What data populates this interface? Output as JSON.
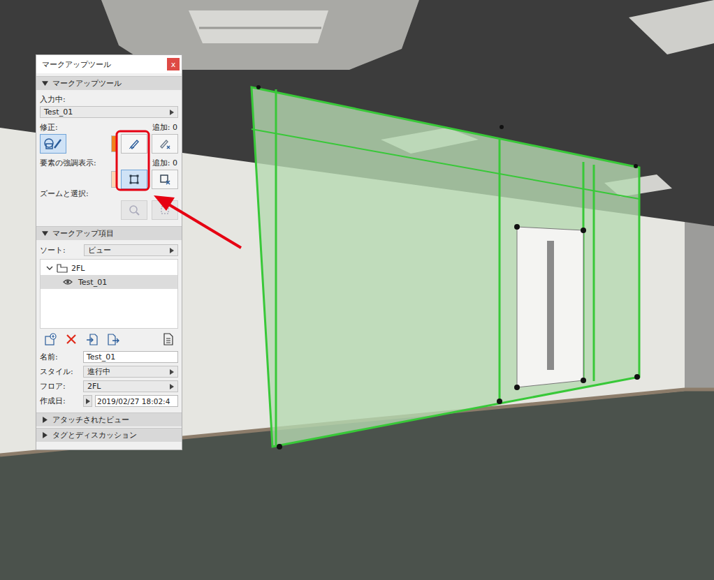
{
  "window": {
    "title": "マークアップツール",
    "close": "x"
  },
  "tool_section": {
    "title": "マークアップツール",
    "expanded": true,
    "active_label": "入力中:",
    "active_value": "Test_01",
    "modify": {
      "label": "修正:",
      "added": "追加: 0",
      "mode_selected": true,
      "color": "#f0821e",
      "add_selected": false,
      "remove_selected": false
    },
    "highlight": {
      "label": "要素の強調表示:",
      "added": "追加: 0",
      "color": "#fcd6b4",
      "add_selected": true,
      "remove_selected": false
    },
    "zoom": {
      "label": "ズームと選択:",
      "disabled": true
    }
  },
  "items_section": {
    "title": "マークアップ項目",
    "expanded": true,
    "sort_label": "ソート:",
    "sort_value": "ビュー",
    "tree": [
      {
        "label": "2FL",
        "expanded": true,
        "children": [
          {
            "label": "Test_01",
            "selected": true,
            "visible": true
          }
        ]
      }
    ]
  },
  "properties": [
    {
      "label": "名前:",
      "value": "Test_01",
      "kind": "input"
    },
    {
      "label": "スタイル:",
      "value": "進行中",
      "kind": "dropdown"
    },
    {
      "label": "フロア:",
      "value": "2FL",
      "kind": "dropdown"
    },
    {
      "label": "作成日:",
      "value": "2019/02/27 18:02:4",
      "kind": "date"
    }
  ],
  "collapsed_sections": [
    {
      "title": "アタッチされたビュー",
      "expanded": false
    },
    {
      "title": "タグとディスカッション",
      "expanded": false
    }
  ]
}
